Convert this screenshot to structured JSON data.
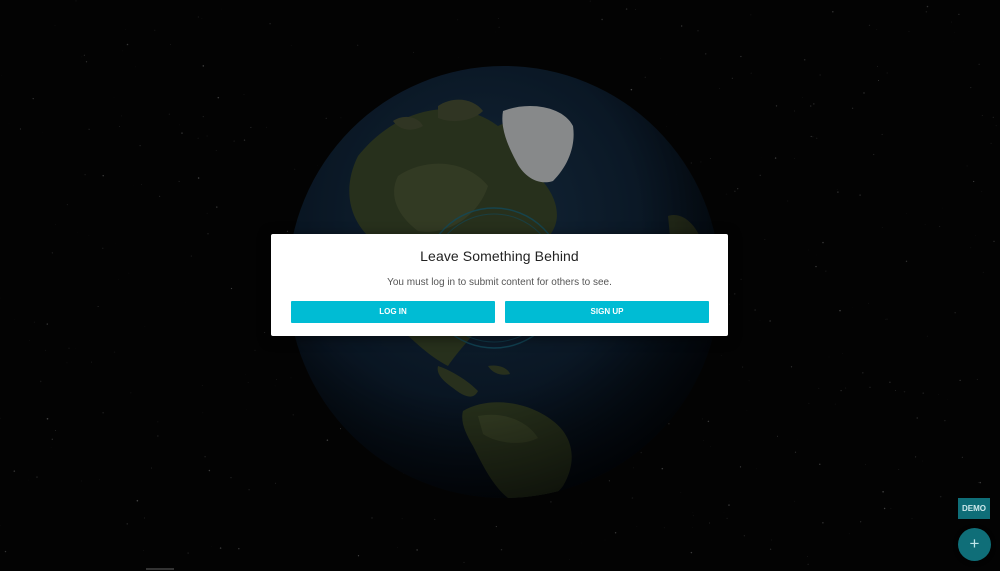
{
  "modal": {
    "title": "Leave Something Behind",
    "message": "You must log in to submit content for others to see.",
    "login_label": "LOG IN",
    "signup_label": "SIGN UP"
  },
  "demo_label": "DEMO",
  "fab_symbol": "+",
  "icons": {
    "globe": "earth-globe",
    "add": "plus-icon"
  },
  "colors": {
    "accent": "#00bcd4",
    "fab": "#0f6e78",
    "background": "#050505"
  }
}
